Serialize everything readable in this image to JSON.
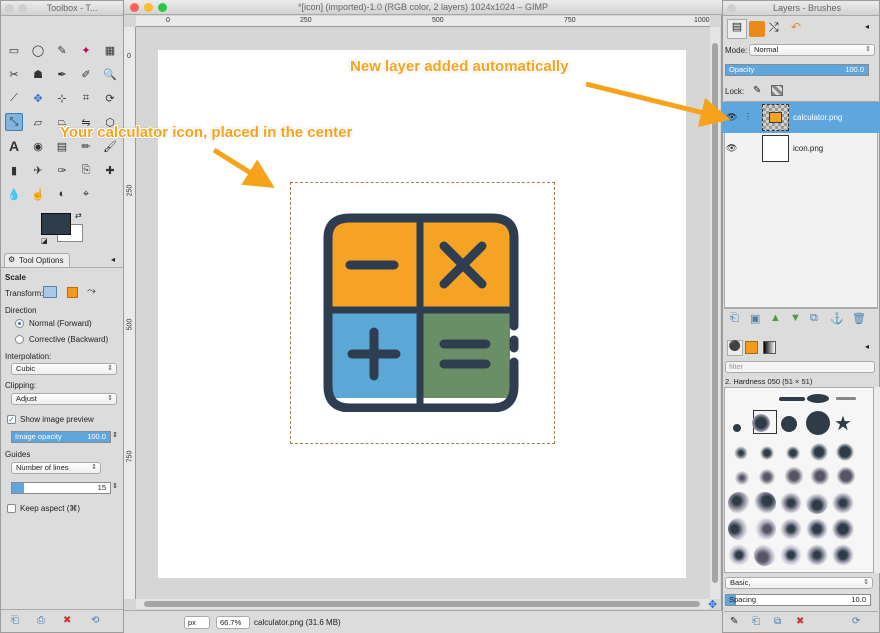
{
  "toolbox": {
    "title": "Toolbox - T...",
    "tool_options_tab": "Tool Options",
    "tool_name": "Scale",
    "transform_label": "Transform:",
    "direction_label": "Direction",
    "direction_options": [
      "Normal (Forward)",
      "Corrective (Backward)"
    ],
    "interpolation_label": "Interpolation:",
    "interpolation_value": "Cubic",
    "clipping_label": "Clipping:",
    "clipping_value": "Adjust",
    "show_preview_label": "Show image preview",
    "image_opacity_label": "Image opacity",
    "image_opacity_value": "100.0",
    "guides_label": "Guides",
    "guides_value": "Number of lines",
    "guides_count": "15",
    "keep_aspect_label": "Keep aspect  (⌘)"
  },
  "image_window": {
    "title": "*[icon] (imported)-1.0 (RGB color, 2 layers) 1024x1024 – GIMP",
    "ruler_marks": [
      "0",
      "250",
      "500",
      "750",
      "1000"
    ],
    "ruler_v_marks": [
      "0",
      "250",
      "500",
      "750"
    ],
    "unit": "px",
    "zoom": "66.7%",
    "status": "calculator.png (31.6 MB)"
  },
  "annotations": {
    "calculator": "Your calculator icon, placed in the center",
    "layer": "New layer added automatically"
  },
  "layers_panel": {
    "title": "Layers - Brushes",
    "mode_label": "Mode:",
    "mode_value": "Normal",
    "opacity_label": "Opacity",
    "opacity_value": "100.0",
    "lock_label": "Lock:",
    "layers": [
      {
        "name": "calculator.png",
        "selected": true
      },
      {
        "name": "icon.png",
        "selected": false
      }
    ]
  },
  "brushes_panel": {
    "filter_placeholder": "filter",
    "brush_name": "2. Hardness 050 (51 × 51)",
    "preset": "Basic,",
    "spacing_label": "Spacing",
    "spacing_value": "10.0"
  },
  "colors": {
    "annotation": "#f7a21b",
    "selection_blue": "#5da6de",
    "calc_orange": "#f6a225",
    "calc_blue": "#5ba8d6",
    "calc_green": "#6a8f66",
    "calc_dark": "#2e3e50"
  }
}
